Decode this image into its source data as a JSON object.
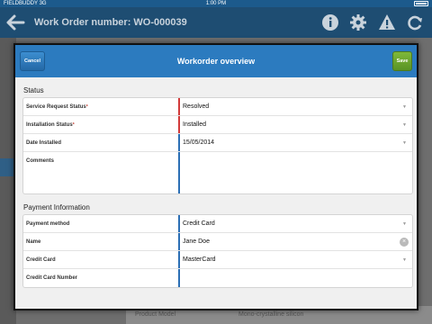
{
  "status_bar": {
    "carrier": "FIELDBUDDY 3G",
    "time": "1:00 PM"
  },
  "app_header": {
    "title": "Work Order number: WO-000039"
  },
  "background": {
    "footer_label": "Product Model",
    "footer_value": "Mono-crystalline silicon"
  },
  "modal": {
    "title": "Workorder overview",
    "cancel_label": "Cancel",
    "save_label": "Save"
  },
  "status_section": {
    "title": "Status",
    "rows": [
      {
        "label": "Service Request Status",
        "required": true,
        "value": "Resolved",
        "control": "select"
      },
      {
        "label": "Installation Status",
        "required": true,
        "value": "Installed",
        "control": "select"
      },
      {
        "label": "Date Installed",
        "required": false,
        "value": "15/05/2014",
        "control": "select"
      },
      {
        "label": "Comments",
        "required": false,
        "value": "",
        "control": "textarea"
      }
    ]
  },
  "payment_section": {
    "title": "Payment Information",
    "rows": [
      {
        "label": "Payment method",
        "value": "Credit Card",
        "control": "select"
      },
      {
        "label": "Name",
        "value": "Jane Doe",
        "control": "text-clear"
      },
      {
        "label": "Credit Card",
        "value": "MasterCard",
        "control": "select"
      },
      {
        "label": "Credit Card Number",
        "value": "",
        "control": "text"
      }
    ]
  },
  "colors": {
    "header_blue": "#2c7bbf",
    "save_green": "#6ea82f",
    "required_red": "#d23a3a",
    "field_blue": "#2c6fb5"
  },
  "icons": [
    "back-arrow-icon",
    "info-icon",
    "gear-icon",
    "warning-icon",
    "refresh-icon",
    "chevron-down-icon",
    "clear-icon"
  ]
}
